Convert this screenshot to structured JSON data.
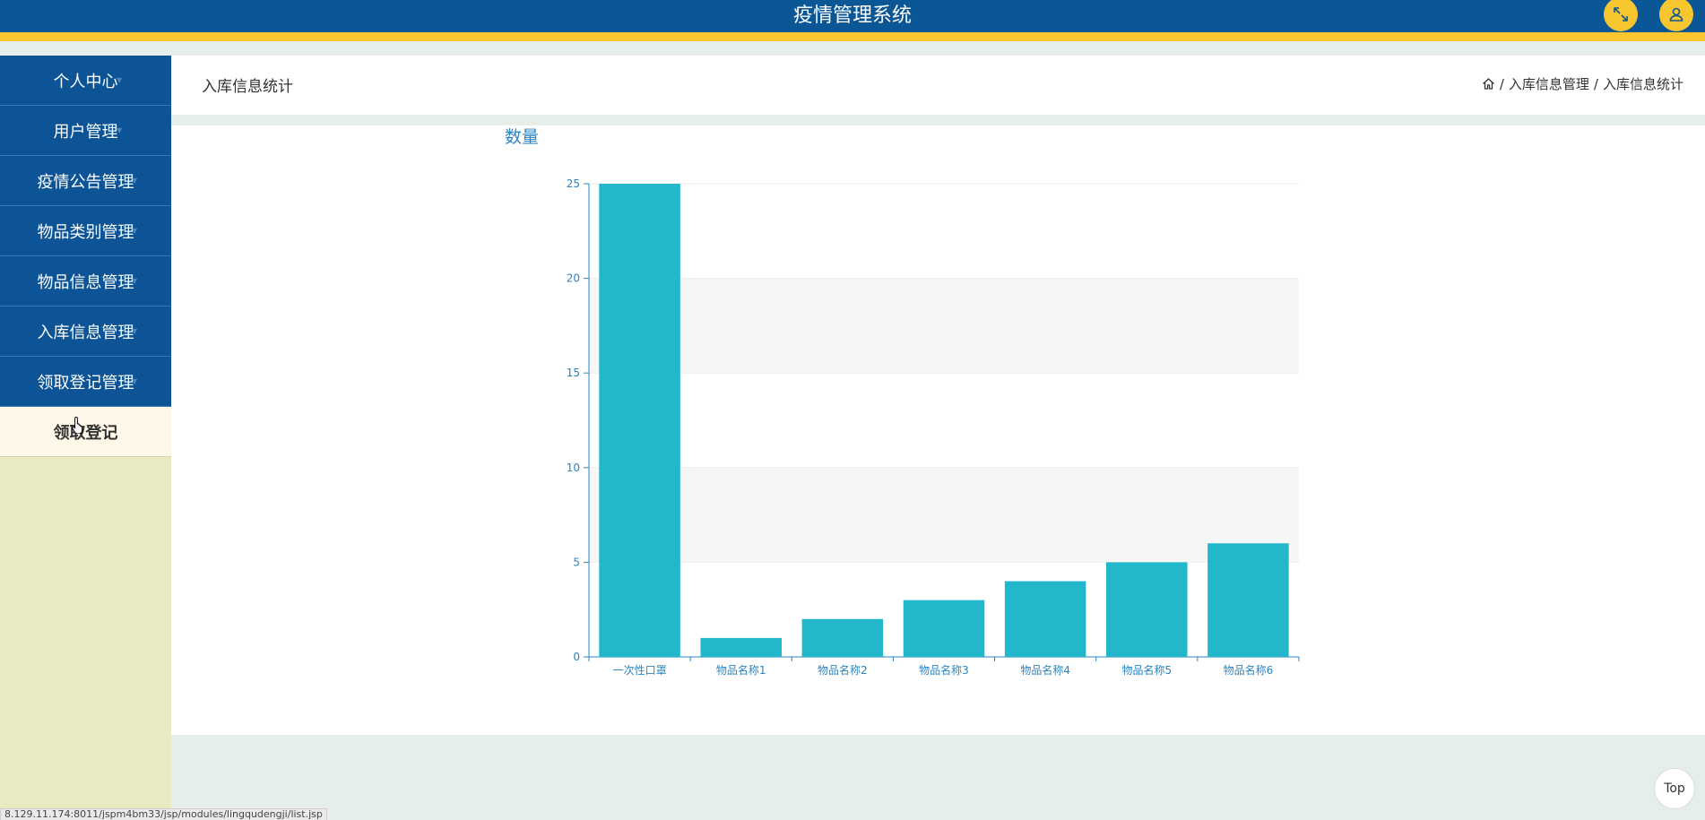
{
  "header": {
    "title": "疫情管理系统",
    "fullscreen_icon": "fullscreen-icon",
    "user_icon": "user-icon",
    "accent_color": "#f8c62e",
    "brand_color": "#0b5796"
  },
  "sidebar": {
    "items": [
      {
        "label": "个人中心"
      },
      {
        "label": "用户管理"
      },
      {
        "label": "疫情公告管理"
      },
      {
        "label": "物品类别管理"
      },
      {
        "label": "物品信息管理"
      },
      {
        "label": "入库信息管理"
      },
      {
        "label": "领取登记管理"
      }
    ],
    "sub_item": {
      "label": "领取登记"
    }
  },
  "page": {
    "title": "入库信息统计",
    "breadcrumb": [
      "入库信息管理",
      "入库信息统计"
    ],
    "breadcrumb_sep": "/"
  },
  "chart_data": {
    "type": "bar",
    "title": "数量",
    "categories": [
      "一次性口罩",
      "物品名称1",
      "物品名称2",
      "物品名称3",
      "物品名称4",
      "物品名称5",
      "物品名称6"
    ],
    "values": [
      25,
      1,
      2,
      3,
      4,
      5,
      6
    ],
    "ylim": [
      0,
      25
    ],
    "yticks": [
      0,
      5,
      10,
      15,
      20,
      25
    ],
    "bar_color": "#22b7cb",
    "axis_color": "#2a85c4",
    "grid": true
  },
  "footer": {
    "status_url": "8.129.11.174:8011/jspm4bm33/jsp/modules/lingqudengji/list.jsp",
    "top_button": "Top"
  }
}
